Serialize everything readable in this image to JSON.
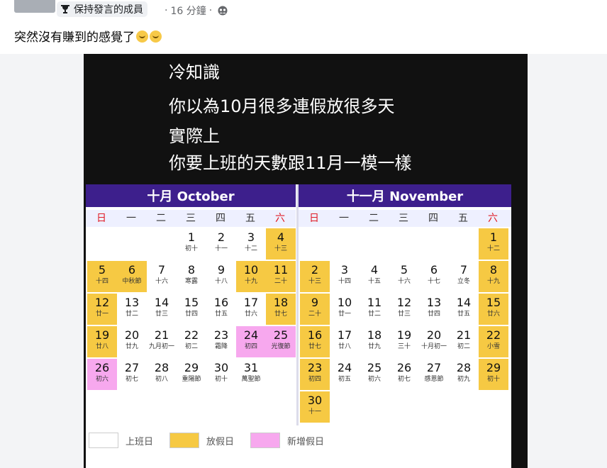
{
  "post": {
    "badge_label": "保持發言的成員",
    "timestamp": "16 分鐘",
    "text": "突然沒有賺到的感覺了"
  },
  "image": {
    "caption_lines": [
      "冷知識",
      "你以為10月很多連假放很多天",
      "實際上",
      "你要上班的天數跟11月一模一樣"
    ]
  },
  "calendar": {
    "october": {
      "title": "十月 October",
      "weekdays": [
        "日",
        "一",
        "二",
        "三",
        "四",
        "五",
        "六"
      ],
      "days": [
        {
          "d": "1",
          "l": "初十",
          "s": ""
        },
        {
          "d": "2",
          "l": "十一",
          "s": ""
        },
        {
          "d": "3",
          "l": "十二",
          "s": ""
        },
        {
          "d": "4",
          "l": "十三",
          "s": "holiday"
        },
        {
          "d": "5",
          "l": "十四",
          "s": "holiday"
        },
        {
          "d": "6",
          "l": "中秋節",
          "s": "holiday"
        },
        {
          "d": "7",
          "l": "十六",
          "s": ""
        },
        {
          "d": "8",
          "l": "寒露",
          "s": ""
        },
        {
          "d": "9",
          "l": "十八",
          "s": ""
        },
        {
          "d": "10",
          "l": "十九",
          "s": "holiday"
        },
        {
          "d": "11",
          "l": "二十",
          "s": "holiday"
        },
        {
          "d": "12",
          "l": "廿一",
          "s": "holiday"
        },
        {
          "d": "13",
          "l": "廿二",
          "s": ""
        },
        {
          "d": "14",
          "l": "廿三",
          "s": ""
        },
        {
          "d": "15",
          "l": "廿四",
          "s": ""
        },
        {
          "d": "16",
          "l": "廿五",
          "s": ""
        },
        {
          "d": "17",
          "l": "廿六",
          "s": ""
        },
        {
          "d": "18",
          "l": "廿七",
          "s": "holiday"
        },
        {
          "d": "19",
          "l": "廿八",
          "s": "holiday"
        },
        {
          "d": "20",
          "l": "廿九",
          "s": ""
        },
        {
          "d": "21",
          "l": "九月初一",
          "s": ""
        },
        {
          "d": "22",
          "l": "初二",
          "s": ""
        },
        {
          "d": "23",
          "l": "霜降",
          "s": ""
        },
        {
          "d": "24",
          "l": "初四",
          "s": "newholiday"
        },
        {
          "d": "25",
          "l": "光復節",
          "s": "newholiday"
        },
        {
          "d": "26",
          "l": "初六",
          "s": "newholiday"
        },
        {
          "d": "27",
          "l": "初七",
          "s": ""
        },
        {
          "d": "28",
          "l": "初八",
          "s": ""
        },
        {
          "d": "29",
          "l": "重陽節",
          "s": ""
        },
        {
          "d": "30",
          "l": "初十",
          "s": ""
        },
        {
          "d": "31",
          "l": "萬聖節",
          "s": ""
        }
      ]
    },
    "november": {
      "title": "十一月 November",
      "weekdays": [
        "日",
        "一",
        "二",
        "三",
        "四",
        "五",
        "六"
      ],
      "days": [
        {
          "d": "1",
          "l": "十二",
          "s": "holiday"
        },
        {
          "d": "2",
          "l": "十三",
          "s": "holiday"
        },
        {
          "d": "3",
          "l": "十四",
          "s": ""
        },
        {
          "d": "4",
          "l": "十五",
          "s": ""
        },
        {
          "d": "5",
          "l": "十六",
          "s": ""
        },
        {
          "d": "6",
          "l": "十七",
          "s": ""
        },
        {
          "d": "7",
          "l": "立冬",
          "s": ""
        },
        {
          "d": "8",
          "l": "十九",
          "s": "holiday"
        },
        {
          "d": "9",
          "l": "二十",
          "s": "holiday"
        },
        {
          "d": "10",
          "l": "廿一",
          "s": ""
        },
        {
          "d": "11",
          "l": "廿二",
          "s": ""
        },
        {
          "d": "12",
          "l": "廿三",
          "s": ""
        },
        {
          "d": "13",
          "l": "廿四",
          "s": ""
        },
        {
          "d": "14",
          "l": "廿五",
          "s": ""
        },
        {
          "d": "15",
          "l": "廿六",
          "s": "holiday"
        },
        {
          "d": "16",
          "l": "廿七",
          "s": "holiday"
        },
        {
          "d": "17",
          "l": "廿八",
          "s": ""
        },
        {
          "d": "18",
          "l": "廿九",
          "s": ""
        },
        {
          "d": "19",
          "l": "三十",
          "s": ""
        },
        {
          "d": "20",
          "l": "十月初一",
          "s": ""
        },
        {
          "d": "21",
          "l": "初二",
          "s": ""
        },
        {
          "d": "22",
          "l": "小雪",
          "s": "holiday"
        },
        {
          "d": "23",
          "l": "初四",
          "s": "holiday"
        },
        {
          "d": "24",
          "l": "初五",
          "s": ""
        },
        {
          "d": "25",
          "l": "初六",
          "s": ""
        },
        {
          "d": "26",
          "l": "初七",
          "s": ""
        },
        {
          "d": "27",
          "l": "感恩節",
          "s": ""
        },
        {
          "d": "28",
          "l": "初九",
          "s": ""
        },
        {
          "d": "29",
          "l": "初十",
          "s": "holiday"
        },
        {
          "d": "30",
          "l": "十一",
          "s": "holiday"
        }
      ]
    },
    "legend": [
      {
        "label": "上班日",
        "color": "#ffffff"
      },
      {
        "label": "放假日",
        "color": "#f6c943"
      },
      {
        "label": "新增假日",
        "color": "#f7a8ee"
      }
    ]
  }
}
